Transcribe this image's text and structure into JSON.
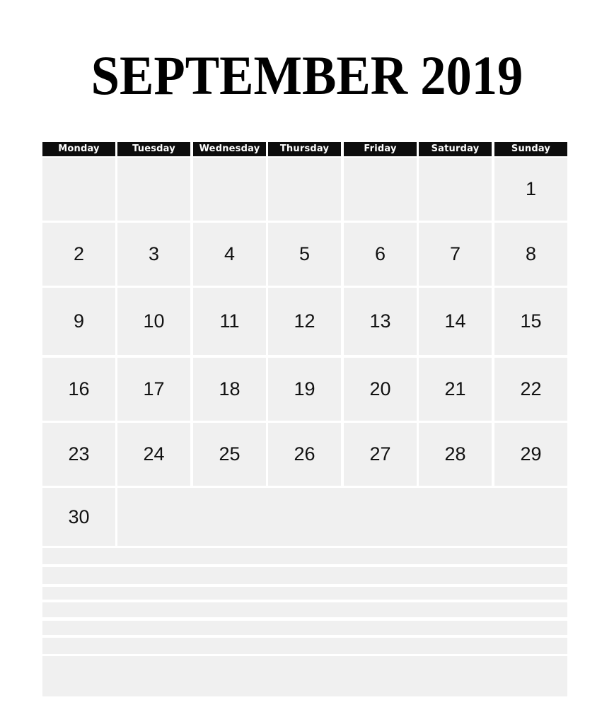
{
  "title": "SEPTEMBER 2019",
  "weekdays": [
    "Monday",
    "Tuesday",
    "Wednesday",
    "Thursday",
    "Friday",
    "Saturday",
    "Sunday"
  ],
  "weeks": [
    [
      "",
      "",
      "",
      "",
      "",
      "",
      "1"
    ],
    [
      "2",
      "3",
      "4",
      "5",
      "6",
      "7",
      "8"
    ],
    [
      "9",
      "10",
      "11",
      "12",
      "13",
      "14",
      "15"
    ],
    [
      "16",
      "17",
      "18",
      "19",
      "20",
      "21",
      "22"
    ],
    [
      "23",
      "24",
      "25",
      "26",
      "27",
      "28",
      "29"
    ],
    [
      "30"
    ]
  ],
  "notes_lines": 7,
  "colors": {
    "header_bg": "#0d0d0d",
    "cell_bg": "#f0f0f0",
    "text": "#111111"
  }
}
